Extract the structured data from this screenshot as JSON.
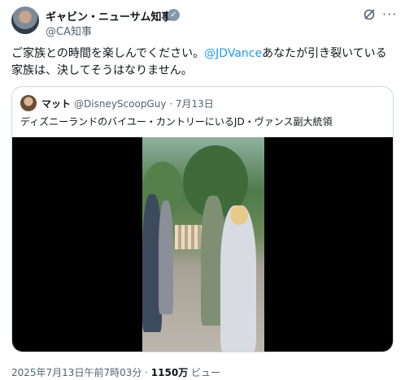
{
  "author": {
    "name": "ギャビン・ニューサム知事",
    "handle": "@CA知事"
  },
  "tweet": {
    "text_before": "ご家族との時間を楽しんでください。",
    "mention": "@JDVance",
    "text_after": "あなたが引き裂いている家族は、決してそうはなりません。"
  },
  "quoted": {
    "name": "マット",
    "handle_date": "@DisneyScoopGuy · 7月13日",
    "text": "ディズニーランドのバイユー・カントリーにいるJD・ヴァンス副大統領"
  },
  "footer": {
    "timestamp": "2025年7月13日午前7時03分 · ",
    "views_count": "1150万",
    "views_label": " ビュー"
  },
  "icons": {
    "verified": "verified-badge-icon",
    "grok": "grok-icon",
    "more": "more-icon"
  },
  "colors": {
    "mention": "#1d9bf0",
    "secondary_text": "#536471",
    "border": "#cfd9de"
  }
}
